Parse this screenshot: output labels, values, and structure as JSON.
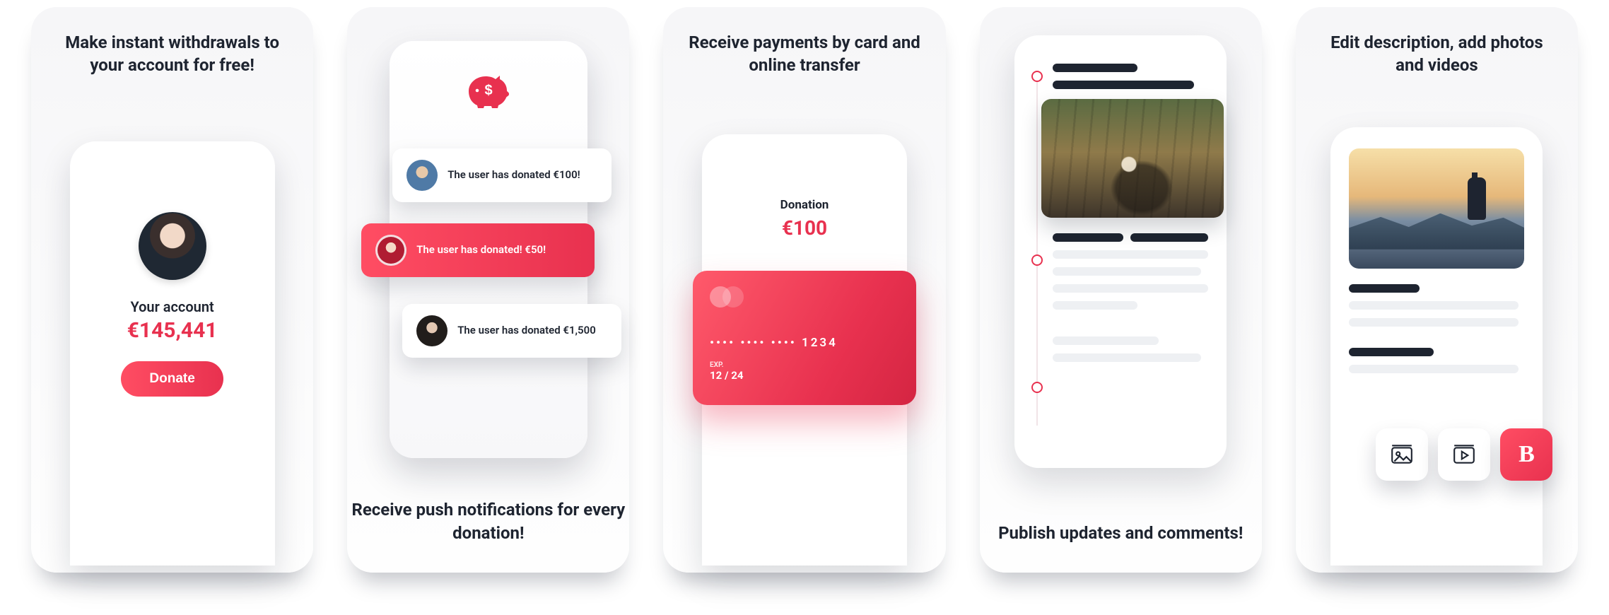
{
  "colors": {
    "accent": "#e8314f",
    "text": "#1e2430"
  },
  "panel1": {
    "heading": "Make instant withdrawals to your account for free!",
    "account_label": "Your account",
    "account_value": "€145,441",
    "donate_label": "Donate"
  },
  "panel2": {
    "notifications": [
      {
        "text": "The user has donated €100!"
      },
      {
        "text": "The user has donated! €50!"
      },
      {
        "text": "The user has donated €1,500"
      }
    ],
    "heading": "Receive push notifications for every donation!"
  },
  "panel3": {
    "heading": "Receive payments by card and online transfer",
    "donation_label": "Donation",
    "donation_value": "€100",
    "card": {
      "number_masked": "•••• •••• •••• 1234",
      "exp_label": "EXP.",
      "exp_value": "12 / 24"
    }
  },
  "panel4": {
    "heading": "Publish updates and comments!"
  },
  "panel5": {
    "heading": "Edit description, add photos and videos",
    "toolbar": {
      "image_icon": "image-icon",
      "video_icon": "video-icon",
      "bold_label": "B"
    }
  }
}
